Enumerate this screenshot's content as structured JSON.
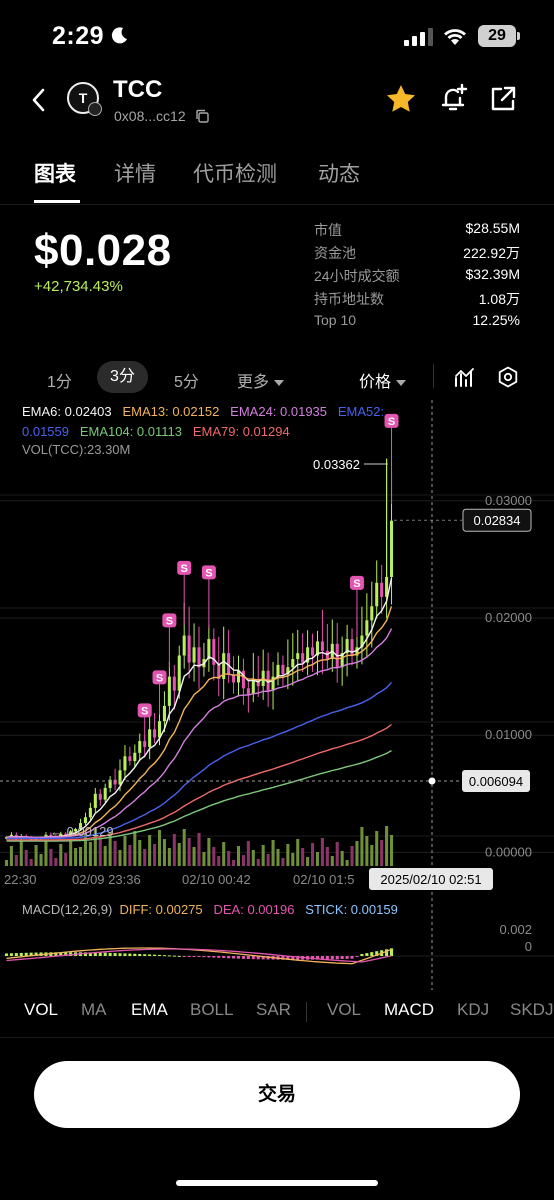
{
  "status": {
    "time": "2:29",
    "battery": "29"
  },
  "header": {
    "token_symbol": "TCC",
    "address": "0x08...cc12",
    "logo_letter": "T"
  },
  "tabs": [
    {
      "label": "图表",
      "active": true
    },
    {
      "label": "详情",
      "active": false
    },
    {
      "label": "代币检测",
      "active": false
    },
    {
      "label": "动态",
      "active": false
    }
  ],
  "price": {
    "value": "$0.028",
    "change": "+42,734.43%"
  },
  "stats": [
    {
      "label": "市值",
      "value": "$28.55M"
    },
    {
      "label": "资金池",
      "value": "222.92万"
    },
    {
      "label": "24小时成交额",
      "value": "$32.39M"
    },
    {
      "label": "持币地址数",
      "value": "1.08万"
    },
    {
      "label": "Top 10",
      "value": "12.25%"
    }
  ],
  "intervals": {
    "i1": "1分",
    "i3": "3分",
    "i5": "5分",
    "more": "更多",
    "price_type": "价格"
  },
  "ema": {
    "ema6": "EMA6: 0.02403",
    "ema13": "EMA13: 0.02152",
    "ema24": "EMA24: 0.01935",
    "ema52_a": "EMA52:",
    "ema52_b": "0.01559",
    "ema104": "EMA104: 0.01113",
    "ema79": "EMA79: 0.01294",
    "vol": "VOL(TCC):23.30M"
  },
  "chart_data": {
    "type": "candlestick",
    "y_ticks": [
      "0.03000",
      "0.02000",
      "0.01000",
      "0.00000"
    ],
    "y_tick_values": [
      0.03,
      0.02,
      0.01,
      0.0
    ],
    "x_ticks": [
      "22:30",
      "02/09 23:36",
      "02/10 00:42",
      "02/10 01:5"
    ],
    "current_price_label": "0.02834",
    "current_price": 0.02834,
    "crosshair_price_label": "0.006094",
    "crosshair_price": 0.006094,
    "crosshair_time_label": "2025/02/10 02:51",
    "high_label": "0.03362",
    "low_label": "0.00129",
    "ylim": [
      -0.0015,
      0.0322
    ],
    "candles_close": [
      0.0013,
      0.0015,
      0.0012,
      0.0014,
      0.0013,
      0.0011,
      0.0012,
      0.0013,
      0.0015,
      0.0014,
      0.0013,
      0.0016,
      0.0015,
      0.0018,
      0.002,
      0.0025,
      0.003,
      0.0038,
      0.005,
      0.0045,
      0.0055,
      0.0062,
      0.0058,
      0.007,
      0.0082,
      0.0078,
      0.0085,
      0.0095,
      0.009,
      0.0105,
      0.0098,
      0.0112,
      0.0125,
      0.015,
      0.0138,
      0.0168,
      0.0185,
      0.0162,
      0.0175,
      0.0158,
      0.0165,
      0.0182,
      0.016,
      0.0148,
      0.017,
      0.0152,
      0.0145,
      0.0155,
      0.014,
      0.0135,
      0.0148,
      0.0142,
      0.0155,
      0.0138,
      0.015,
      0.016,
      0.0152,
      0.0158,
      0.0165,
      0.017,
      0.0162,
      0.0175,
      0.0168,
      0.018,
      0.0172,
      0.0165,
      0.0178,
      0.0158,
      0.017,
      0.0182,
      0.0168,
      0.0175,
      0.0185,
      0.0198,
      0.021,
      0.023,
      0.0218,
      0.0235,
      0.0283
    ],
    "ema_series": [
      {
        "name": "EMA6",
        "color": "#f4f4f4"
      },
      {
        "name": "EMA13",
        "color": "#f2b35a"
      },
      {
        "name": "EMA24",
        "color": "#d47fe0"
      },
      {
        "name": "EMA52",
        "color": "#4862ee"
      },
      {
        "name": "EMA104",
        "color": "#7cc97a"
      },
      {
        "name": "EMA79",
        "color": "#ee6a6a"
      }
    ],
    "markers_S": [
      28,
      31,
      33,
      36,
      41,
      71,
      79
    ],
    "up_color": "#b8ef5b",
    "down_color": "#e455b2"
  },
  "macd": {
    "label": "MACD(12,26,9)",
    "diff": "DIFF: 0.00275",
    "dea": "DEA: 0.00196",
    "stick": "STICK: 0.00159",
    "tick_top": "0.002",
    "tick_zero": "0"
  },
  "indicator_tabs": [
    {
      "label": "VOL",
      "on": true
    },
    {
      "label": "MA",
      "on": false
    },
    {
      "label": "EMA",
      "on": true
    },
    {
      "label": "BOLL",
      "on": false
    },
    {
      "label": "SAR",
      "on": false
    },
    {
      "label": "VOL",
      "on": false
    },
    {
      "label": "MACD",
      "on": true
    },
    {
      "label": "KDJ",
      "on": false
    },
    {
      "label": "SKDJ",
      "on": false
    }
  ],
  "trade_button": "交易",
  "colors": {
    "accent_green": "#b8ef5b",
    "accent_pink": "#e455b2",
    "star": "#f5b829"
  }
}
